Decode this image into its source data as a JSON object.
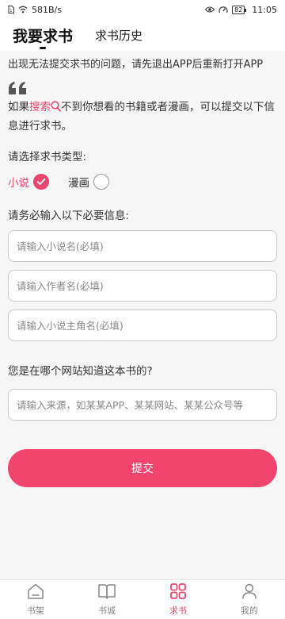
{
  "status_bar": {
    "network_speed": "581B/s",
    "battery_level": "82",
    "time": "11:05"
  },
  "header": {
    "tabs": [
      {
        "label": "我要求书",
        "active": true
      },
      {
        "label": "求书历史",
        "active": false
      }
    ]
  },
  "notice": "出现无法提交求书的问题，请先退出APP后重新打开APP",
  "intro": {
    "prefix": "如果",
    "highlight": "搜索",
    "suffix": "不到你想看的书籍或者漫画，可以提交以下信息进行求书。"
  },
  "book_type": {
    "label": "请选择求书类型:",
    "options": [
      {
        "label": "小说",
        "selected": true
      },
      {
        "label": "漫画",
        "selected": false
      }
    ]
  },
  "required_info": {
    "label": "请务必输入以下必要信息:",
    "fields": [
      {
        "value": "",
        "placeholder": "请输入小说名(必填)"
      },
      {
        "value": "",
        "placeholder": "请输入作者名(必填)"
      },
      {
        "value": "",
        "placeholder": "请输入小说主角名(必填)"
      }
    ]
  },
  "source": {
    "label": "您是在哪个网站知道这本书的?",
    "value": "",
    "placeholder": "请输入来源，如某某APP、某某网站、某某公众号等"
  },
  "submit_label": "提交",
  "bottom_nav": {
    "items": [
      {
        "label": "书架",
        "icon": "bookshelf-icon",
        "active": false
      },
      {
        "label": "书城",
        "icon": "book-open-icon",
        "active": false
      },
      {
        "label": "求书",
        "icon": "grid-icon",
        "active": true
      },
      {
        "label": "我的",
        "icon": "person-icon",
        "active": false
      }
    ]
  },
  "colors": {
    "accent": "#e8456f",
    "button": "#f2456e",
    "background": "#f6f6f6"
  }
}
